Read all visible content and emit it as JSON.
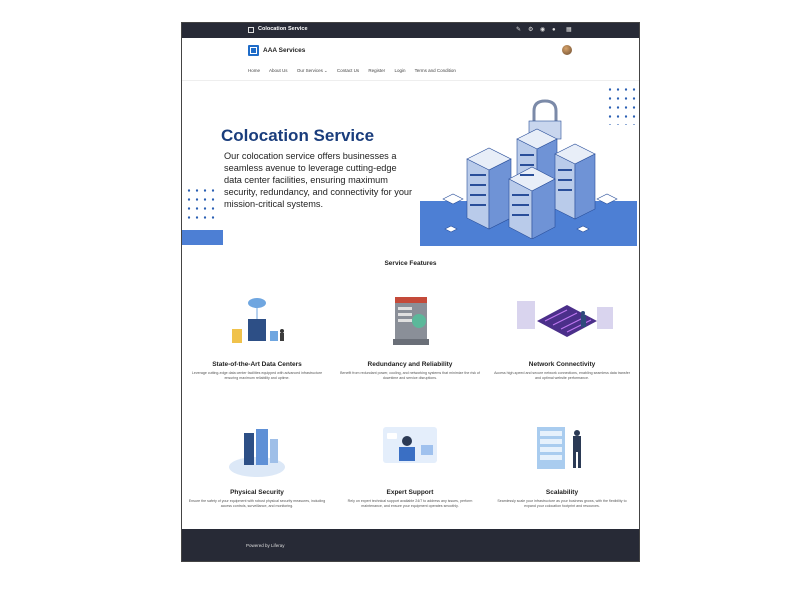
{
  "topbar": {
    "title": "Colocation Service",
    "icons": [
      "panel-icon",
      "edit-icon",
      "gear-icon",
      "globe-icon",
      "info-icon",
      "grid-icon"
    ]
  },
  "header": {
    "brand": "AAA Services",
    "nav": [
      "Home",
      "About Us",
      "Our Services",
      "Contact Us",
      "Register",
      "Login",
      "Terms and Condition"
    ]
  },
  "hero": {
    "title": "Colocation Service",
    "text": "Our colocation service offers businesses a seamless avenue to leverage cutting-edge data center facilities, ensuring maximum security, redundancy, and connectivity for your mission-critical systems."
  },
  "features": {
    "title": "Service Features",
    "items": [
      {
        "title": "State-of-the-Art Data Centers",
        "desc": "Leverage cutting-edge data center facilities equipped with advanced infrastructure ensuring maximum reliability and uptime."
      },
      {
        "title": "Redundancy and Reliability",
        "desc": "Benefit from redundant power, cooling, and networking systems that minimize the risk of downtime and service disruptions."
      },
      {
        "title": "Network Connectivity",
        "desc": "Access high-speed and secure network connections, enabling seamless data transfer and optimal website performance."
      },
      {
        "title": "Physical Security",
        "desc": "Ensure the safety of your equipment with robust physical security measures, including access controls, surveillance, and monitoring."
      },
      {
        "title": "Expert Support",
        "desc": "Rely on expert technical support available 24/7 to address any issues, perform maintenance, and ensure your equipment operates smoothly."
      },
      {
        "title": "Scalability",
        "desc": "Seamlessly scale your infrastructure as your business grows, with the flexibility to expand your colocation footprint and resources."
      }
    ]
  },
  "footer": {
    "powered": "Powered by Liferay"
  },
  "colors": {
    "brand_blue": "#1f6cc8",
    "hero_blue": "#4d7fd4",
    "title_navy": "#1a3d7c",
    "dark_bar": "#272a36"
  }
}
